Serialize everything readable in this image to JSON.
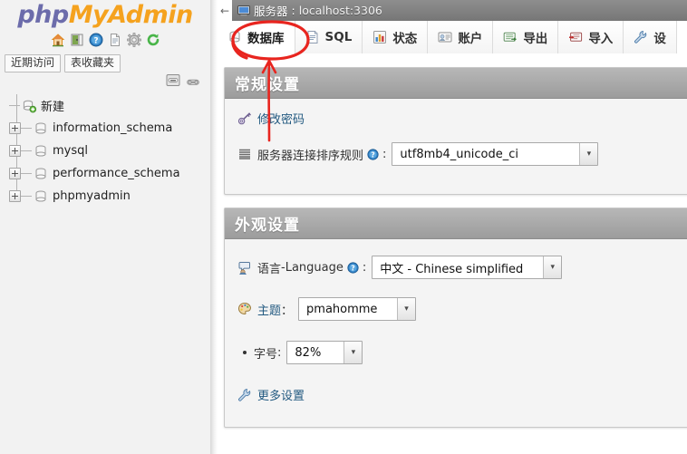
{
  "app": {
    "logo_php": "php",
    "logo_my": "My",
    "logo_admin": "Admin"
  },
  "sidebar": {
    "icons": [
      {
        "name": "home-icon",
        "title": "主页"
      },
      {
        "name": "logout-icon",
        "title": "退出"
      },
      {
        "name": "help-icon",
        "title": "帮助"
      },
      {
        "name": "docs-icon",
        "title": "文档"
      },
      {
        "name": "settings-gear-icon",
        "title": "设置"
      },
      {
        "name": "reload-icon",
        "title": "重新载入"
      }
    ],
    "quick_tabs": [
      {
        "label": "近期访问"
      },
      {
        "label": "表收藏夹"
      }
    ],
    "panel_controls": [
      {
        "name": "collapse-panel-button"
      },
      {
        "name": "link-chain-icon"
      }
    ],
    "tree": [
      {
        "label": "新建",
        "expandable": false,
        "icon": "new-database-icon"
      },
      {
        "label": "information_schema",
        "expandable": true,
        "icon": "database-icon"
      },
      {
        "label": "mysql",
        "expandable": true,
        "icon": "database-icon"
      },
      {
        "label": "performance_schema",
        "expandable": true,
        "icon": "database-icon"
      },
      {
        "label": "phpmyadmin",
        "expandable": true,
        "icon": "database-icon"
      }
    ]
  },
  "server_bar": {
    "back_glyph": "←",
    "prefix": "服务器",
    "separator": ": ",
    "host": "localhost:3306",
    "icon": "server-icon"
  },
  "tabs": [
    {
      "label": "数据库",
      "icon": "database-tab-icon",
      "active": true,
      "name": "tab-databases"
    },
    {
      "label": "SQL",
      "icon": "sql-tab-icon",
      "active": false,
      "name": "tab-sql"
    },
    {
      "label": "状态",
      "icon": "status-tab-icon",
      "active": false,
      "name": "tab-status"
    },
    {
      "label": "账户",
      "icon": "accounts-tab-icon",
      "active": false,
      "name": "tab-accounts"
    },
    {
      "label": "导出",
      "icon": "export-tab-icon",
      "active": false,
      "name": "tab-export"
    },
    {
      "label": "导入",
      "icon": "import-tab-icon",
      "active": false,
      "name": "tab-import"
    },
    {
      "label": "设",
      "icon": "settings-tab-icon",
      "active": false,
      "name": "tab-settings"
    }
  ],
  "general_settings": {
    "title": "常规设置",
    "change_password": {
      "label": "修改密码",
      "icon": "key-icon"
    },
    "collation": {
      "label": "服务器连接排序规则",
      "colon": ":",
      "icon": "collation-icon",
      "help_icon": "help-icon",
      "value": "utf8mb4_unicode_ci",
      "arrow": "▾"
    }
  },
  "appearance_settings": {
    "title": "外观设置",
    "language": {
      "label_cn": "语言",
      "dash": " - ",
      "label_en": "Language",
      "colon": ":",
      "icon": "language-icon",
      "help_icon": "help-icon",
      "value": "中文 - Chinese simplified",
      "arrow": "▾"
    },
    "theme": {
      "label": "主题",
      "colon": "：",
      "icon": "palette-icon",
      "value": "pmahomme",
      "arrow": "▾"
    },
    "font_size": {
      "label": "字号",
      "colon": ":",
      "value": "82%",
      "arrow": "▾"
    },
    "more_settings": {
      "label": "更多设置",
      "icon": "wrench-icon"
    }
  },
  "annotation": {
    "color": "#e8251f",
    "shapes": [
      {
        "name": "highlight-ellipse",
        "target": "tab-databases"
      },
      {
        "name": "pointer-arrow",
        "target": "tab-databases"
      }
    ]
  },
  "colors": {
    "logo_php": "#6c6cab",
    "logo_my": "#f5a21e",
    "panel_header_bg": "#a8a8a8",
    "server_bar_bg": "#7d7d7d",
    "link": "#235a81",
    "annotation_red": "#e8251f"
  }
}
